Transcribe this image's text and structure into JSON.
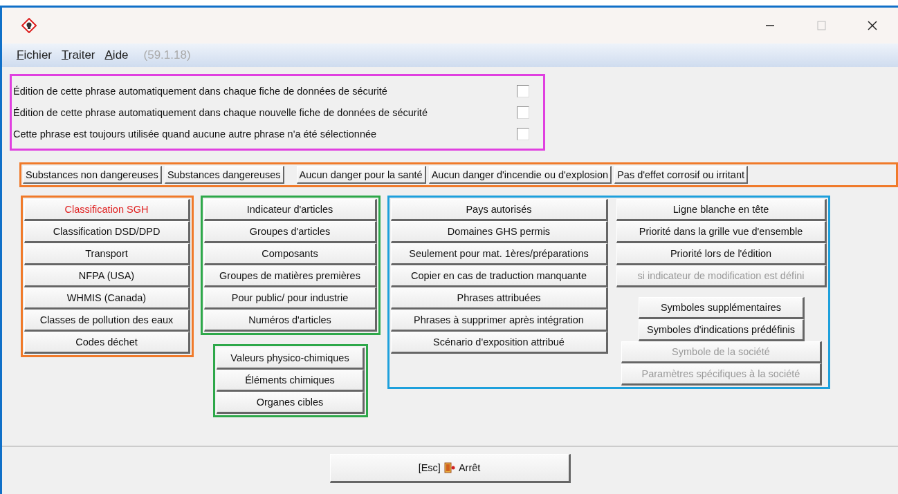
{
  "menu": [
    {
      "label": "Fichier"
    },
    {
      "label": "Traiter"
    },
    {
      "label": "Aide"
    }
  ],
  "version": "(59.1.18)",
  "options": {
    "color": "#e040e0",
    "items": [
      {
        "label": "Édition de cette phrase automatiquement dans chaque fiche de données de sécurité",
        "checked": false
      },
      {
        "label": "Édition de cette phrase automatiquement dans chaque nouvelle fiche de données de sécurité",
        "checked": false
      },
      {
        "label": "Cette phrase est toujours utilisée quand aucune autre phrase n'a été sélectionnée",
        "checked": false
      }
    ]
  },
  "hazard_row": {
    "color": "#f07a2a",
    "buttons": [
      "Substances non dangereuses",
      "Substances dangereuses",
      "Aucun danger pour la santé",
      "Aucun danger d'incendie ou d'explosion",
      "Pas d'effet corrosif ou irritant"
    ]
  },
  "classification": {
    "color": "#f07a2a",
    "buttons": [
      {
        "label": "Classification SGH",
        "highlighted": true
      },
      {
        "label": "Classification DSD/DPD",
        "highlighted": false
      },
      {
        "label": "Transport",
        "highlighted": false
      },
      {
        "label": "NFPA (USA)",
        "highlighted": false
      },
      {
        "label": "WHMIS (Canada)",
        "highlighted": false
      },
      {
        "label": "Classes de pollution des eaux",
        "highlighted": false
      },
      {
        "label": "Codes déchet",
        "highlighted": false
      }
    ]
  },
  "articles": {
    "color": "#2ea84a",
    "buttons": [
      "Indicateur d'articles",
      "Groupes d'articles",
      "Composants",
      "Groupes de matières premières",
      "Pour public/ pour industrie",
      "Numéros d'articles"
    ]
  },
  "chemistry": {
    "color": "#2ea84a",
    "buttons": [
      "Valeurs physico-chimiques",
      "Éléments chimiques",
      "Organes cibles"
    ]
  },
  "settings": {
    "color": "#1ea0dc",
    "left": [
      "Pays autorisés",
      "Domaines GHS permis",
      "Seulement pour mat. 1ères/préparations",
      "Copier en cas de traduction manquante",
      "Phrases attribuées",
      "Phrases à supprimer après intégration",
      "Scénario d'exposition attribué"
    ],
    "right": [
      {
        "label": "Ligne blanche en tête",
        "disabled": false
      },
      {
        "label": "Priorité dans la grille vue d'ensemble",
        "disabled": false
      },
      {
        "label": "Priorité lors de l'édition",
        "disabled": false
      },
      {
        "label": "si indicateur de modification est défini",
        "disabled": true
      }
    ],
    "symbols": [
      {
        "label": "Symboles supplémentaires",
        "disabled": false
      },
      {
        "label": "Symboles d'indications prédéfinis",
        "disabled": false
      },
      {
        "label": "Symbole de la société",
        "disabled": true
      },
      {
        "label": "Paramètres spécifiques à la société",
        "disabled": true
      }
    ]
  },
  "stop_button": {
    "key": "[Esc]",
    "label": "Arrêt"
  }
}
